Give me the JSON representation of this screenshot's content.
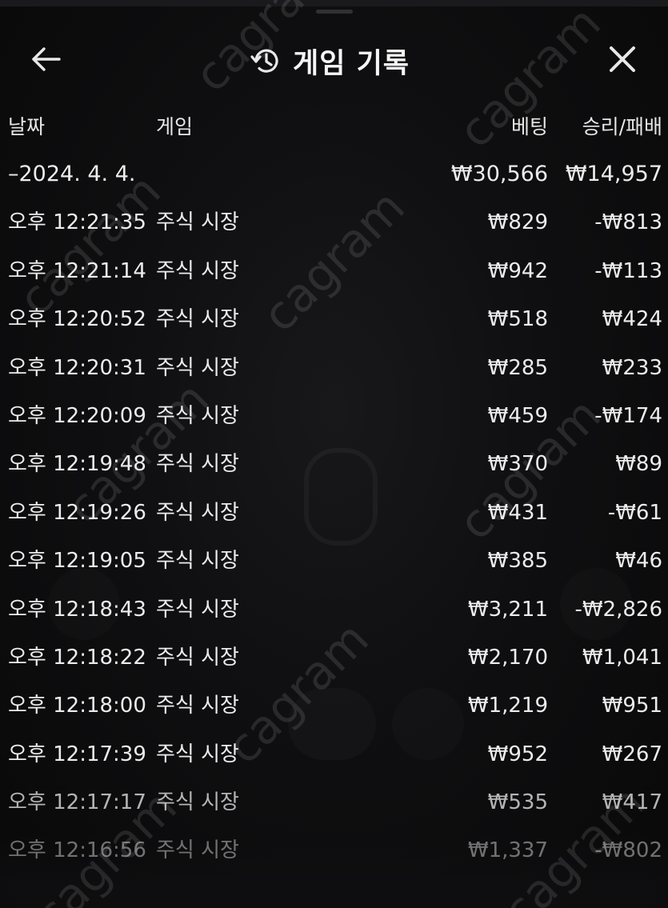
{
  "header": {
    "title": "게임 기록",
    "back_icon": "arrow-left-icon",
    "history_icon": "history-icon",
    "close_icon": "close-icon"
  },
  "columns": {
    "date": "날짜",
    "game": "게임",
    "bet": "베팅",
    "result": "승리/패배"
  },
  "date_group": {
    "date": "–2024. 4. 4.",
    "bet_total": "₩30,566",
    "result_total": "₩14,957"
  },
  "rows": [
    {
      "time": "오후 12:21:35",
      "game": "주식 시장",
      "bet": "₩829",
      "result": "-₩813"
    },
    {
      "time": "오후 12:21:14",
      "game": "주식 시장",
      "bet": "₩942",
      "result": "-₩113"
    },
    {
      "time": "오후 12:20:52",
      "game": "주식 시장",
      "bet": "₩518",
      "result": "₩424"
    },
    {
      "time": "오후 12:20:31",
      "game": "주식 시장",
      "bet": "₩285",
      "result": "₩233"
    },
    {
      "time": "오후 12:20:09",
      "game": "주식 시장",
      "bet": "₩459",
      "result": "-₩174"
    },
    {
      "time": "오후 12:19:48",
      "game": "주식 시장",
      "bet": "₩370",
      "result": "₩89"
    },
    {
      "time": "오후 12:19:26",
      "game": "주식 시장",
      "bet": "₩431",
      "result": "-₩61"
    },
    {
      "time": "오후 12:19:05",
      "game": "주식 시장",
      "bet": "₩385",
      "result": "₩46"
    },
    {
      "time": "오후 12:18:43",
      "game": "주식 시장",
      "bet": "₩3,211",
      "result": "-₩2,826"
    },
    {
      "time": "오후 12:18:22",
      "game": "주식 시장",
      "bet": "₩2,170",
      "result": "₩1,041"
    },
    {
      "time": "오후 12:18:00",
      "game": "주식 시장",
      "bet": "₩1,219",
      "result": "₩951"
    },
    {
      "time": "오후 12:17:39",
      "game": "주식 시장",
      "bet": "₩952",
      "result": "₩267"
    },
    {
      "time": "오후 12:17:17",
      "game": "주식 시장",
      "bet": "₩535",
      "result": "₩417"
    },
    {
      "time": "오후 12:16:56",
      "game": "주식 시장",
      "bet": "₩1,337",
      "result": "-₩802"
    }
  ],
  "watermark": "cagram",
  "colors": {
    "background": "#0b0b0d",
    "text": "#ececec"
  }
}
